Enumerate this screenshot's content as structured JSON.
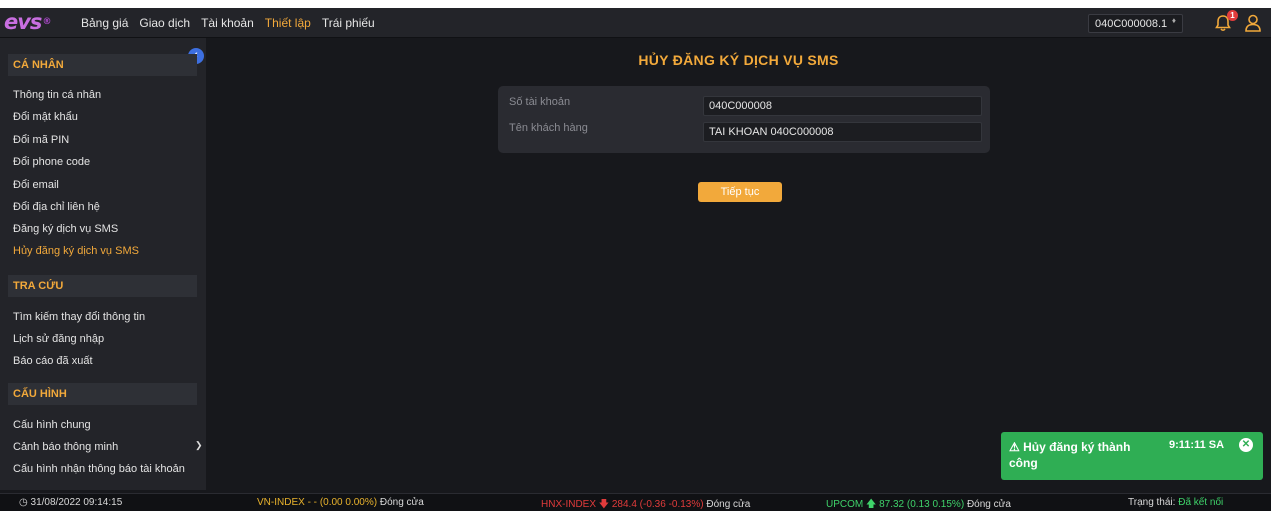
{
  "app": {
    "logo": "evs",
    "colors": {
      "accent": "#f2a93b",
      "panel": "#232429",
      "background": "#17181c",
      "toast": "#2fae54",
      "up": "#3fd26a",
      "down": "#e03b3b"
    }
  },
  "topbar": {
    "nav": [
      "Bảng giá",
      "Giao dịch",
      "Tài khoản",
      "Thiết lập",
      "Trái phiếu"
    ],
    "active_nav": "Thiết lập",
    "account": "040C000008.1",
    "notification_count": "1",
    "icons": [
      "bell-icon",
      "user-icon",
      "chevron-down-icon"
    ]
  },
  "sidebar": {
    "sections": [
      {
        "title": "CÁ NHÂN",
        "items": [
          "Thông tin cá nhân",
          "Đổi mật khẩu",
          "Đổi mã PIN",
          "Đổi phone code",
          "Đổi email",
          "Đổi địa chỉ liên hệ",
          "Đăng ký dịch vụ SMS",
          "Hủy đăng ký dịch vụ SMS"
        ]
      },
      {
        "title": "TRA CỨU",
        "items": [
          "Tìm kiếm thay đổi thông tin",
          "Lịch sử đăng nhập",
          "Báo cáo đã xuất"
        ]
      },
      {
        "title": "CẤU HÌNH",
        "items": [
          "Cấu hình chung",
          "Cảnh báo thông minh",
          "Cấu hình nhận thông báo tài khoản"
        ]
      }
    ],
    "active_item": "Hủy đăng ký dịch vụ SMS"
  },
  "main": {
    "title": "HỦY ĐĂNG KÝ DỊCH VỤ SMS",
    "fields": [
      {
        "label": "Số tài khoản",
        "value": "040C000008"
      },
      {
        "label": "Tên khách hàng",
        "value": "TAI KHOAN 040C000008"
      }
    ],
    "continue_label": "Tiếp tục"
  },
  "toast": {
    "message": "Hủy đăng ký thành công",
    "time": "9:11:11 SA"
  },
  "status": {
    "datetime": "31/08/2022 09:14:15",
    "vnindex": {
      "name": "VN-INDEX",
      "value": "- -",
      "change": "(0.00 0.00%)",
      "state": "Đóng cửa"
    },
    "hnxindex": {
      "name": "HNX-INDEX",
      "value": "284.4",
      "change": "(-0.36 -0.13%)",
      "state": "Đóng cửa"
    },
    "upcom": {
      "name": "UPCOM",
      "value": "87.32",
      "change": "(0.13 0.15%)",
      "state": "Đóng cửa"
    },
    "connection_label": "Trạng thái:",
    "connection_value": "Đã kết nối"
  }
}
